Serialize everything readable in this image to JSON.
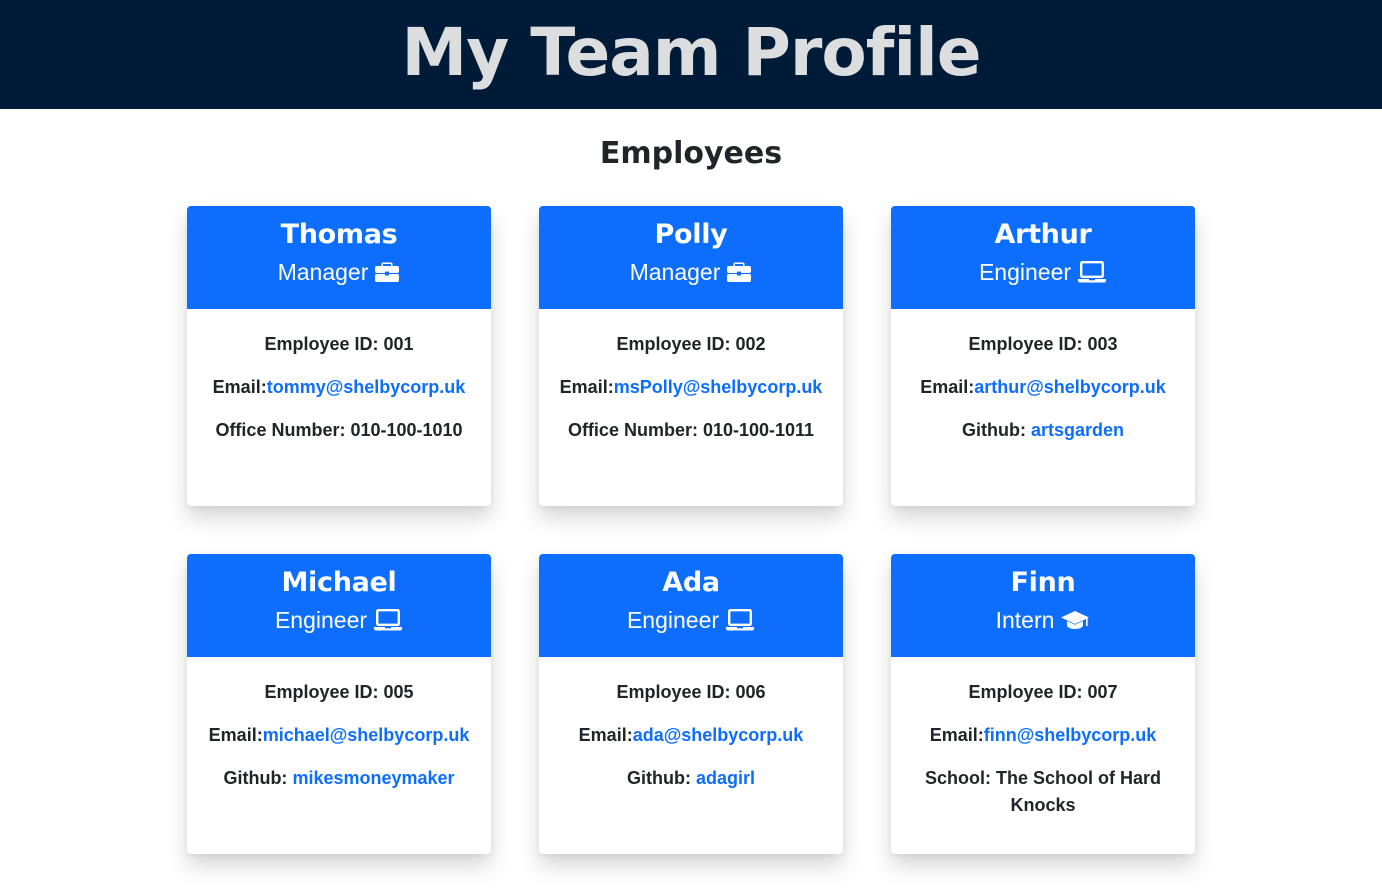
{
  "header": {
    "title": "My Team Profile"
  },
  "section": {
    "title": "Employees"
  },
  "colors": {
    "header_bg": "#001b38",
    "accent": "#0d6efd",
    "header_text": "#dcdddf"
  },
  "employees": [
    {
      "name": "Thomas",
      "role": "Manager",
      "icon": "briefcase-icon",
      "id_label": "Employee ID: 001",
      "email_label": "Email:",
      "email": "tommy@shelbycorp.uk",
      "extra_label": "Office Number: 010-100-1010",
      "extra_link": ""
    },
    {
      "name": "Polly",
      "role": "Manager",
      "icon": "briefcase-icon",
      "id_label": "Employee ID: 002",
      "email_label": "Email:",
      "email": "msPolly@shelbycorp.uk",
      "extra_label": "Office Number: 010-100-1011",
      "extra_link": ""
    },
    {
      "name": "Arthur",
      "role": "Engineer",
      "icon": "laptop-icon",
      "id_label": "Employee ID: 003",
      "email_label": "Email:",
      "email": "arthur@shelbycorp.uk",
      "extra_label": "Github: ",
      "extra_link": "artsgarden"
    },
    {
      "name": "Michael",
      "role": "Engineer",
      "icon": "laptop-icon",
      "id_label": "Employee ID: 005",
      "email_label": "Email:",
      "email": "michael@shelbycorp.uk",
      "extra_label": "Github: ",
      "extra_link": "mikesmoneymaker"
    },
    {
      "name": "Ada",
      "role": "Engineer",
      "icon": "laptop-icon",
      "id_label": "Employee ID: 006",
      "email_label": "Email:",
      "email": "ada@shelbycorp.uk",
      "extra_label": "Github: ",
      "extra_link": "adagirl"
    },
    {
      "name": "Finn",
      "role": "Intern",
      "icon": "graduation-cap-icon",
      "id_label": "Employee ID: 007",
      "email_label": "Email:",
      "email": "finn@shelbycorp.uk",
      "extra_label": "School: The School of Hard Knocks",
      "extra_link": ""
    }
  ]
}
